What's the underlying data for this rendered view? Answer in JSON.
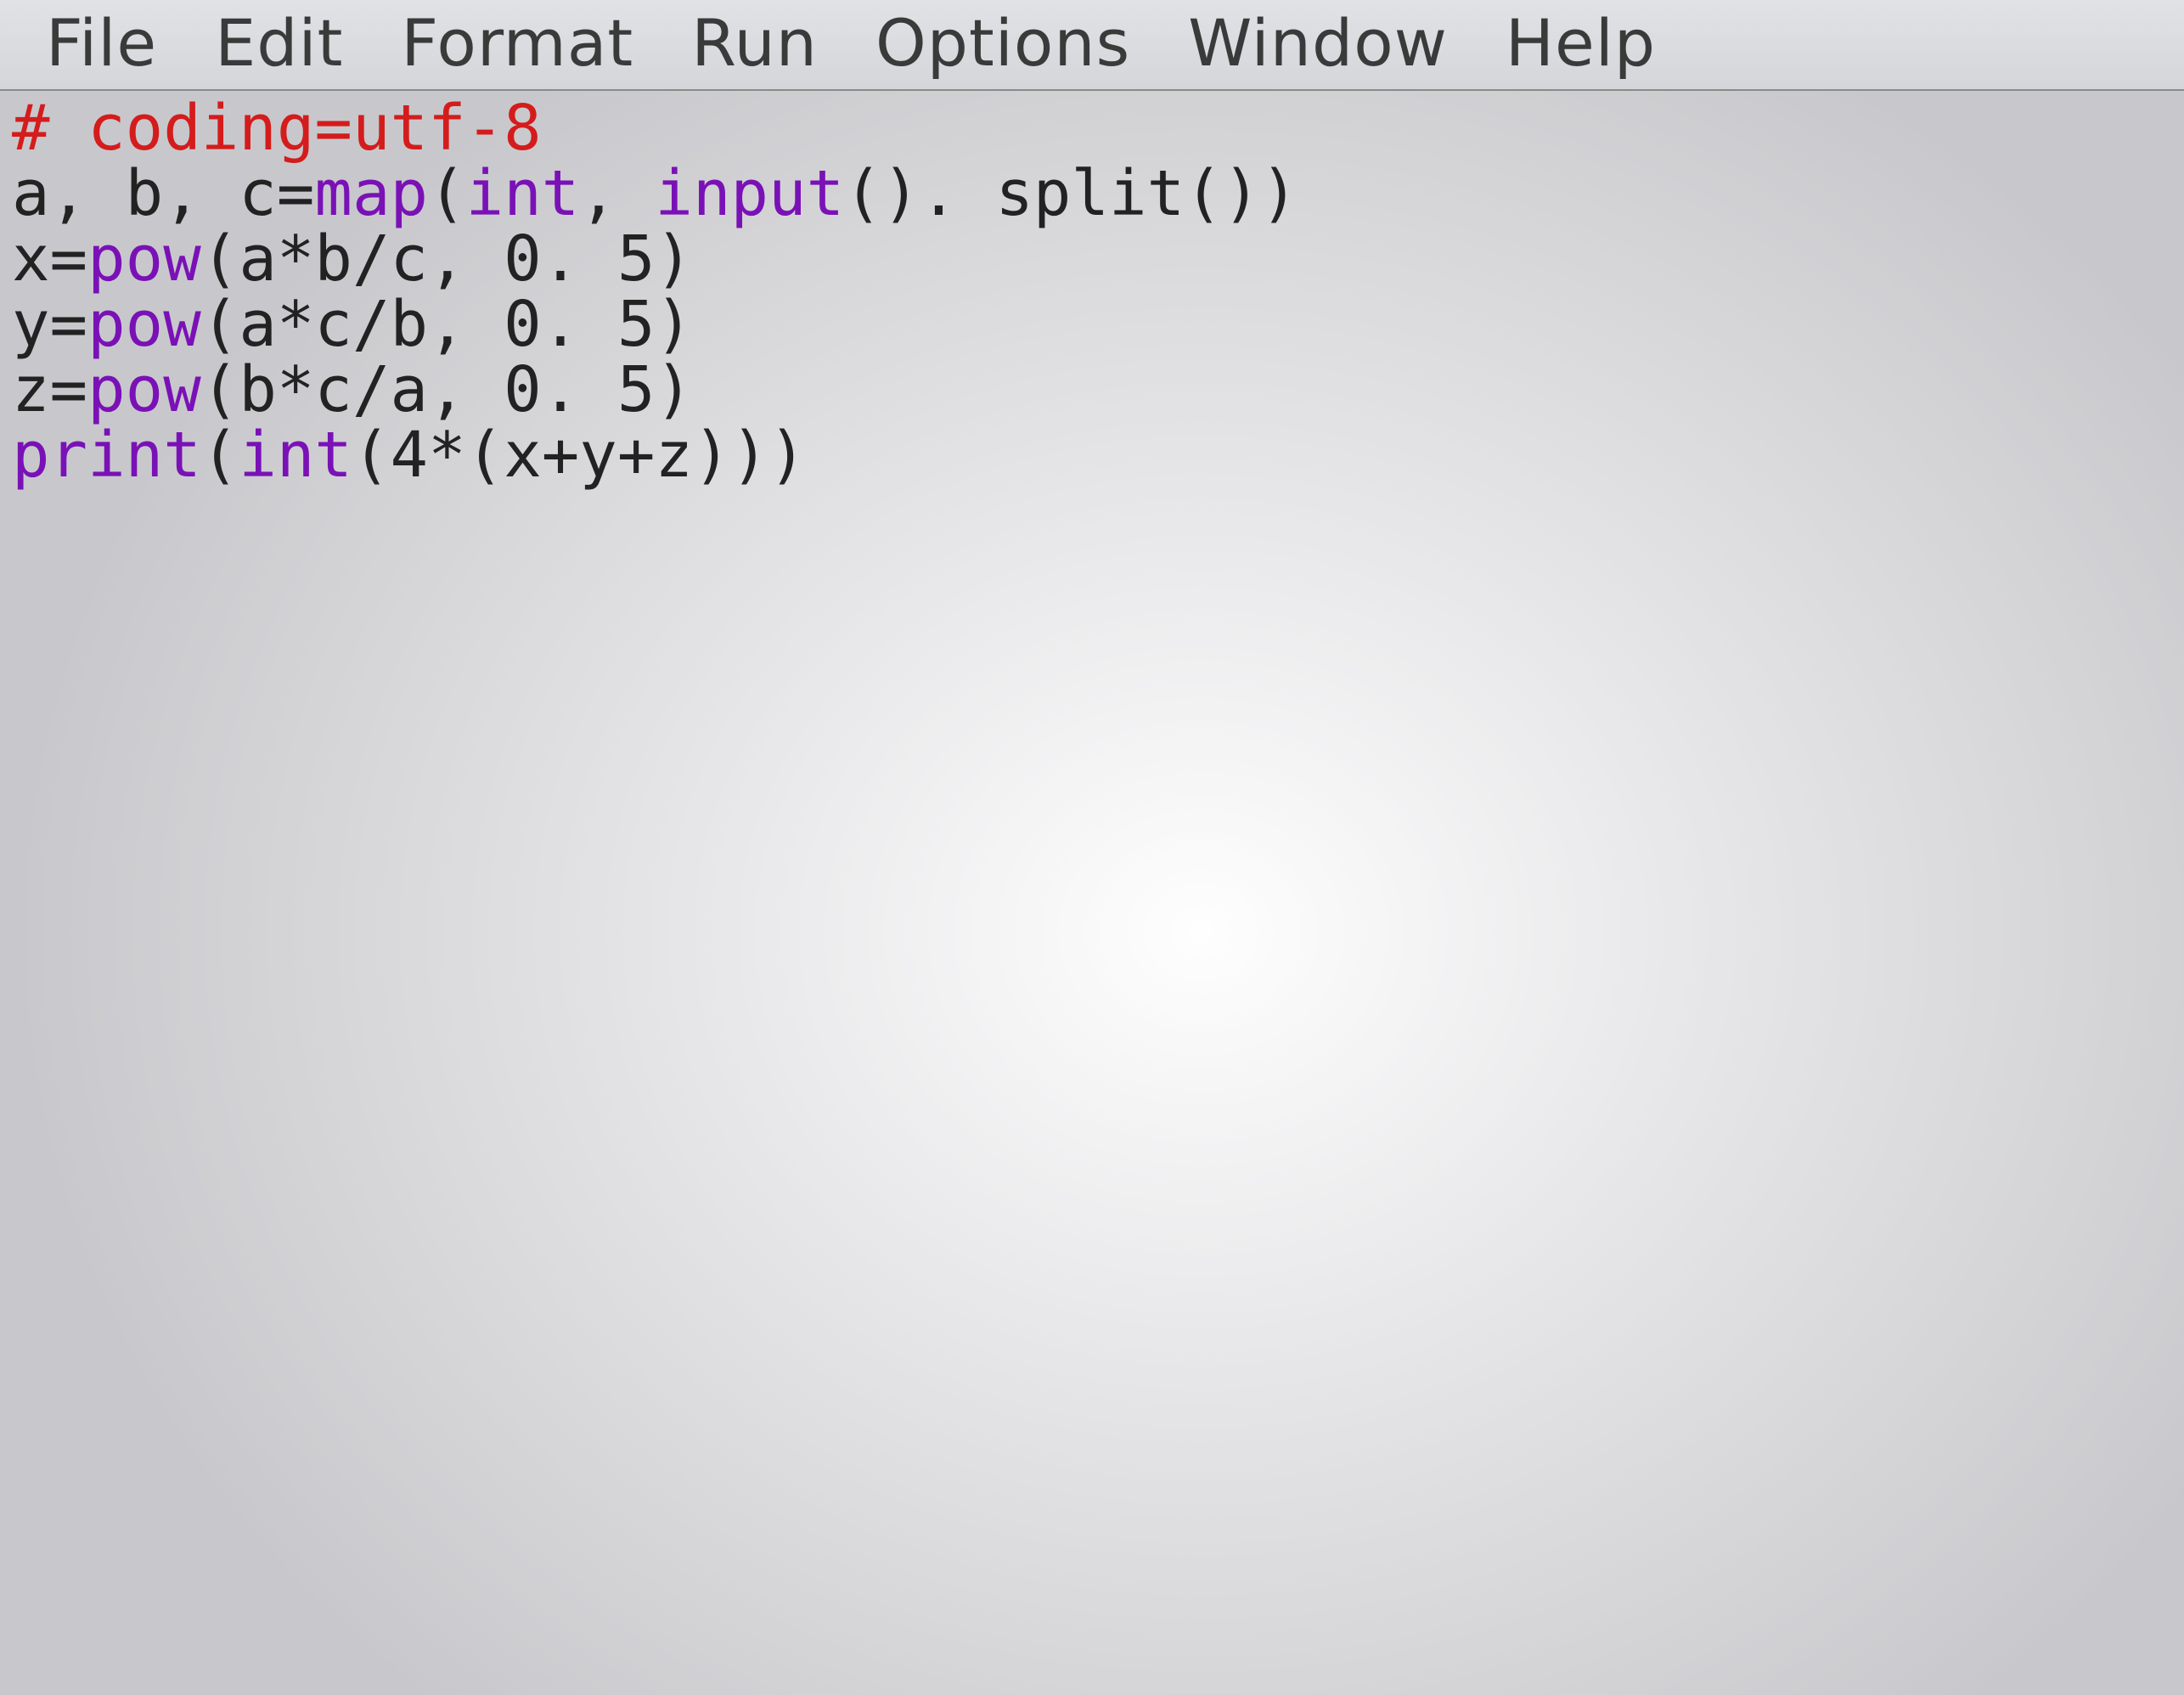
{
  "menu": {
    "file": "File",
    "edit": "Edit",
    "format": "Format",
    "run": "Run",
    "options": "Options",
    "window": "Window",
    "help": "Help"
  },
  "code": {
    "line1": {
      "comment": "# coding=utf-8"
    },
    "line2": {
      "s1": "a, b, c=",
      "s2": "map",
      "s3": "(",
      "s4": "int",
      "s5": ", ",
      "s6": "input",
      "s7": "(). split())"
    },
    "line3": {
      "s1": "x=",
      "s2": "pow",
      "s3": "(a*b/c, 0. 5)"
    },
    "line4": {
      "s1": "y=",
      "s2": "pow",
      "s3": "(a*c/b, 0. 5)"
    },
    "line5": {
      "s1": "z=",
      "s2": "pow",
      "s3": "(b*c/a, 0. 5)"
    },
    "line6": {
      "s1": "print",
      "s2": "(",
      "s3": "int",
      "s4": "(4*(x+y+z)))"
    }
  }
}
